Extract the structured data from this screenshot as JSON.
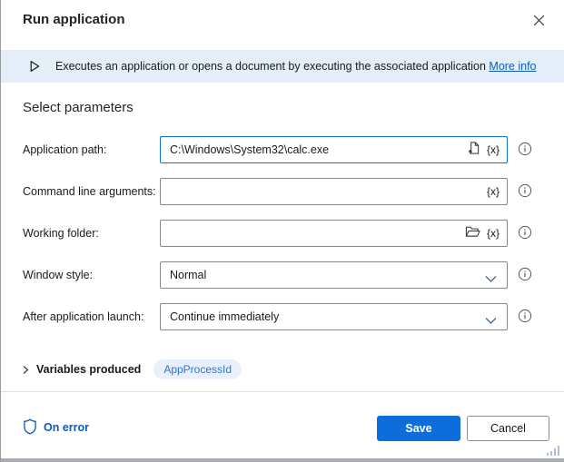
{
  "dialog": {
    "title": "Run application"
  },
  "banner": {
    "text": "Executes an application or opens a document by executing the associated application",
    "link_label": "More info"
  },
  "section_title": "Select parameters",
  "fields": [
    {
      "label": "Application path:",
      "type": "text",
      "value": "C:\\Windows\\System32\\calc.exe",
      "focused": true,
      "icons": [
        "file-picker-icon",
        "variable-icon"
      ]
    },
    {
      "label": "Command line arguments:",
      "type": "text",
      "value": "",
      "icons": [
        "variable-icon"
      ]
    },
    {
      "label": "Working folder:",
      "type": "text",
      "value": "",
      "icons": [
        "folder-picker-icon",
        "variable-icon"
      ]
    },
    {
      "label": "Window style:",
      "type": "select",
      "value": "Normal"
    },
    {
      "label": "After application launch:",
      "type": "select",
      "value": "Continue immediately"
    }
  ],
  "variables_produced": {
    "label": "Variables produced",
    "pills": [
      "AppProcessId"
    ]
  },
  "footer": {
    "on_error_label": "On error",
    "save_label": "Save",
    "cancel_label": "Cancel"
  },
  "icons": {
    "variable_glyph": "{x}"
  },
  "colors": {
    "accent_blue": "#0d6edb",
    "link_blue": "#0b5cbe",
    "banner_bg": "#e4eef9",
    "pill_bg": "#e8f1fb",
    "pill_text": "#2e73d6",
    "input_border": "#8a8886",
    "focus_border": "#0f72d8"
  }
}
